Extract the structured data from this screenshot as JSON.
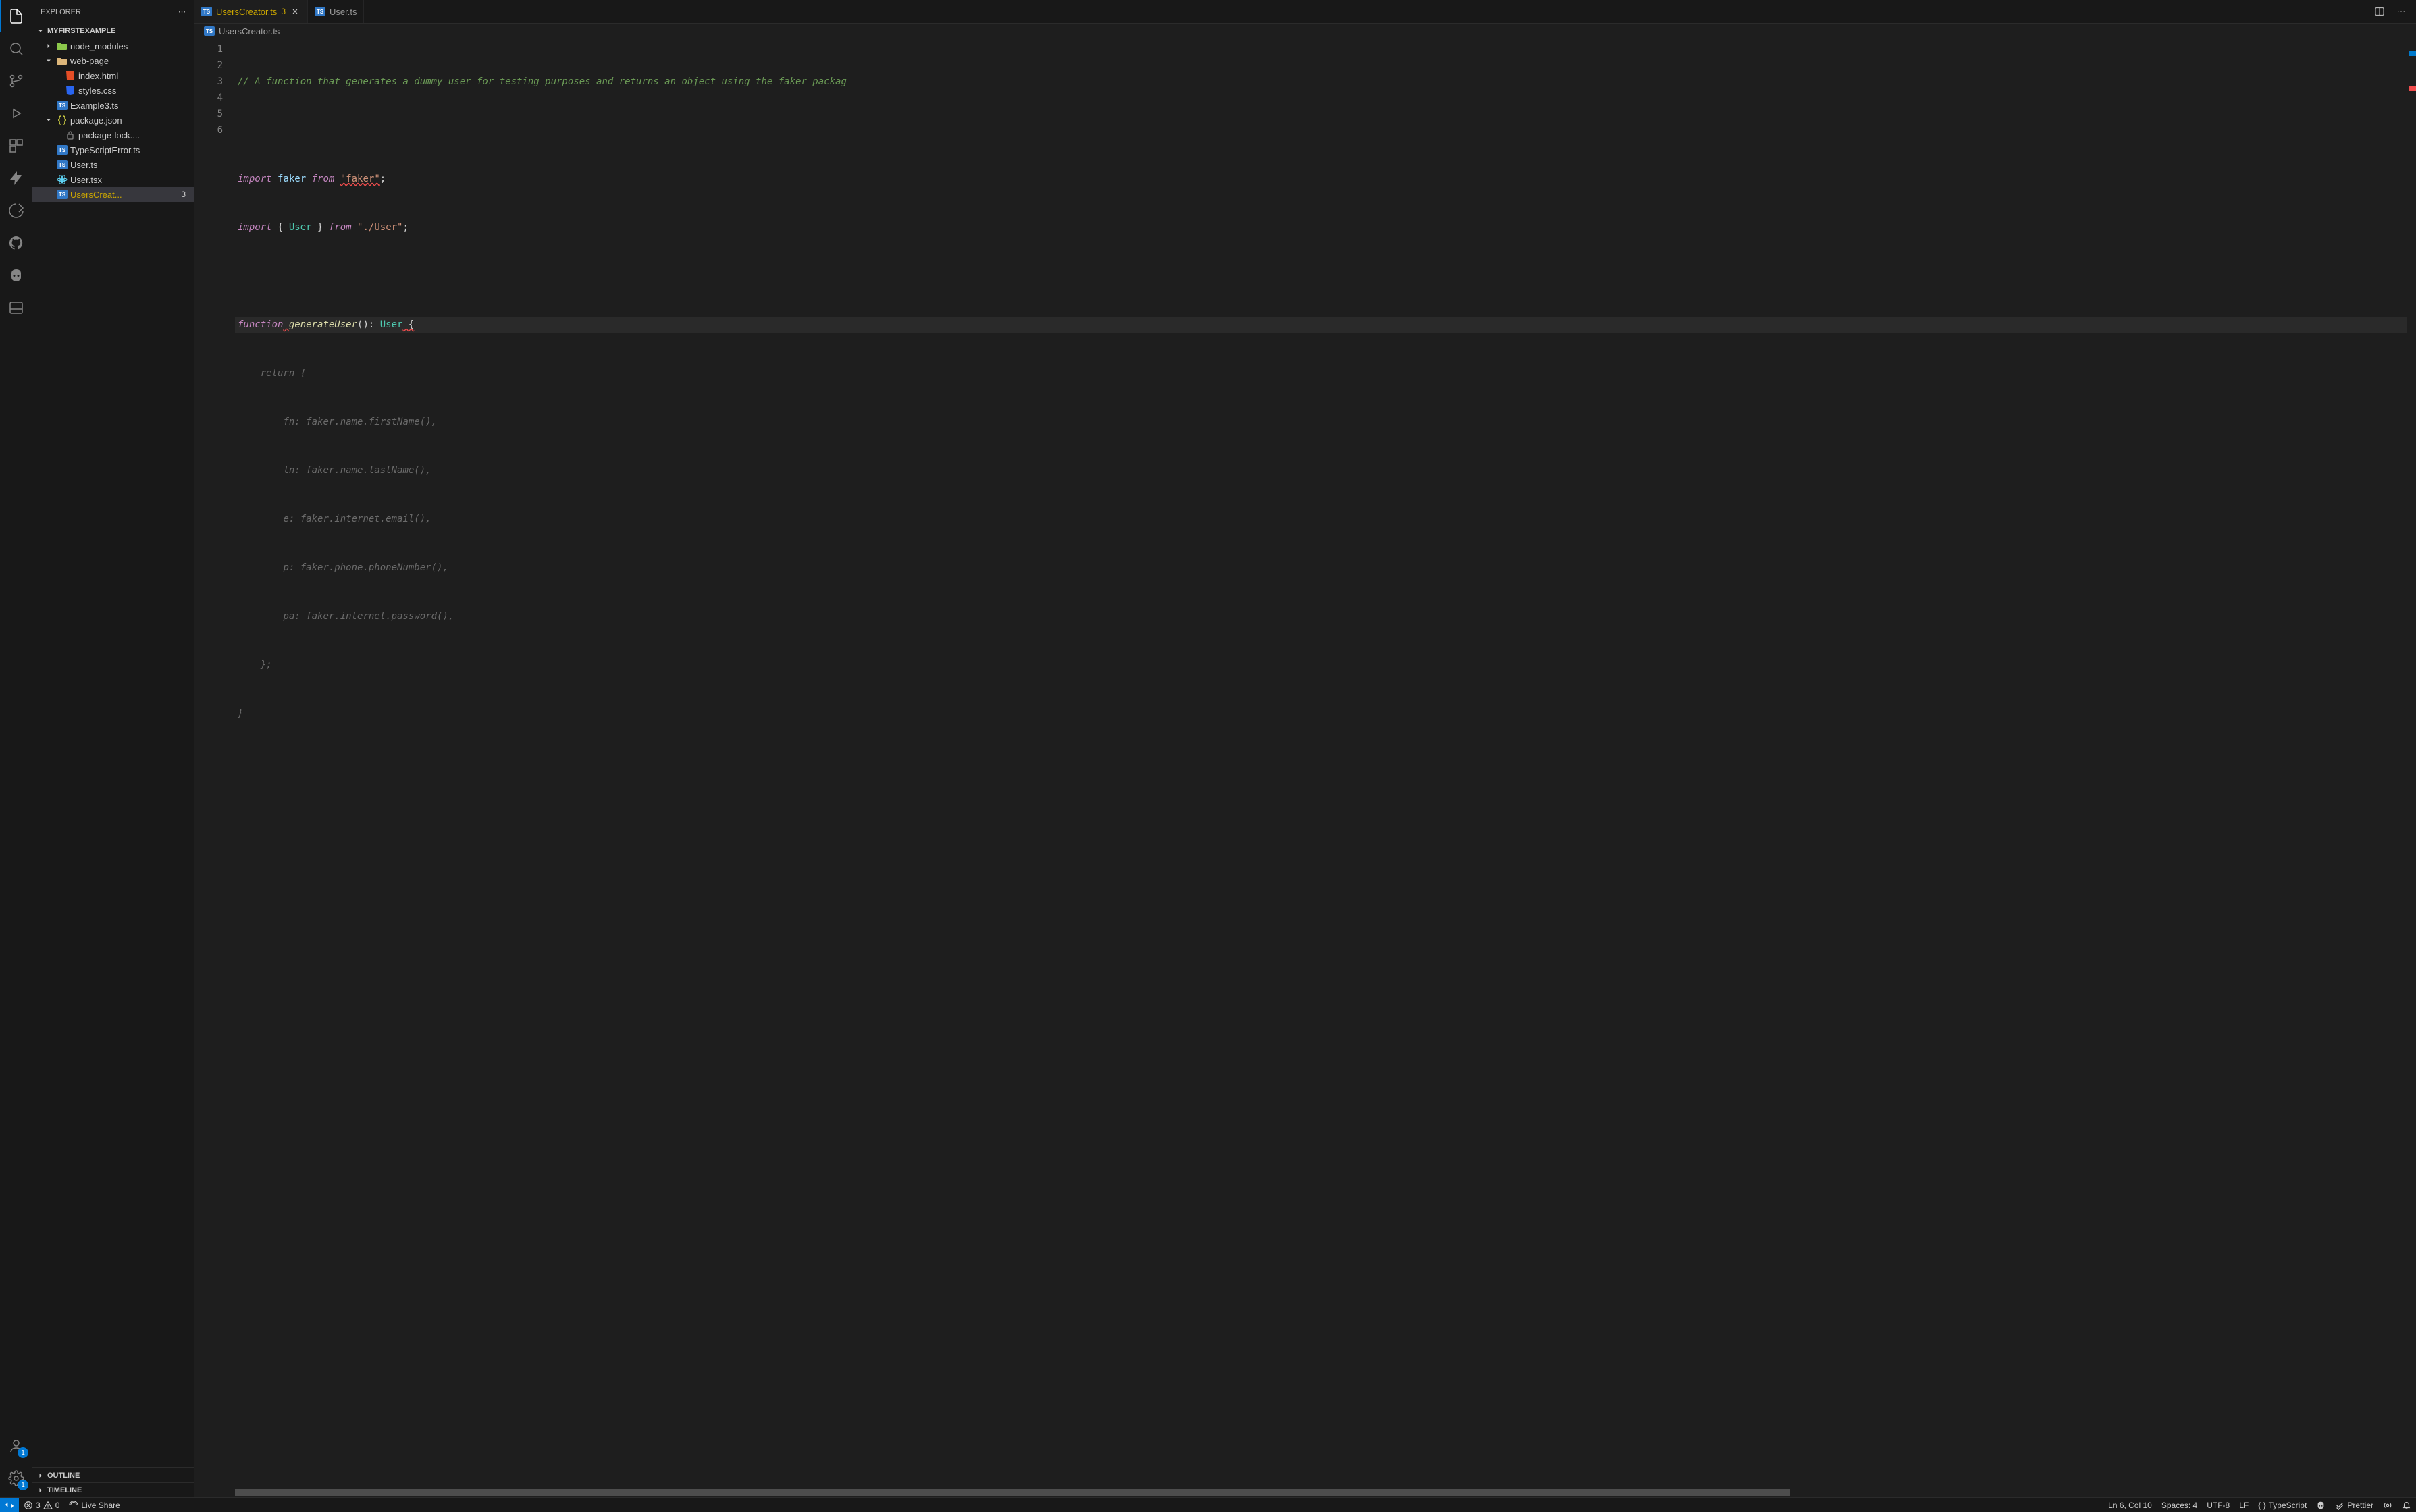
{
  "sidebar": {
    "title": "Explorer",
    "project": "MyFirstExample",
    "outline": "Outline",
    "timeline": "Timeline",
    "items": [
      {
        "label": "node_modules",
        "indent": 1,
        "icon": "nodemod",
        "twistie": "right"
      },
      {
        "label": "web-page",
        "indent": 1,
        "icon": "folder",
        "twistie": "down"
      },
      {
        "label": "index.html",
        "indent": 2,
        "icon": "html"
      },
      {
        "label": "styles.css",
        "indent": 2,
        "icon": "css"
      },
      {
        "label": "Example3.ts",
        "indent": 1,
        "icon": "ts"
      },
      {
        "label": "package.json",
        "indent": 1,
        "icon": "json",
        "twistie": "down"
      },
      {
        "label": "package-lock....",
        "indent": 2,
        "icon": "json-lock"
      },
      {
        "label": "TypeScriptError.ts",
        "indent": 1,
        "icon": "ts"
      },
      {
        "label": "User.ts",
        "indent": 1,
        "icon": "ts"
      },
      {
        "label": "User.tsx",
        "indent": 1,
        "icon": "react"
      },
      {
        "label": "UsersCreat...",
        "indent": 1,
        "icon": "ts",
        "warn": true,
        "badge": "3",
        "active": true
      }
    ]
  },
  "activity": {
    "account_badge": "1",
    "settings_badge": "1"
  },
  "tabs": [
    {
      "label": "UsersCreator.ts",
      "icon": "ts",
      "active": true,
      "warn": true,
      "badge": "3",
      "close": true
    },
    {
      "label": "User.ts",
      "icon": "ts",
      "active": false
    }
  ],
  "breadcrumb": {
    "file": "UsersCreator.ts"
  },
  "gutter": [
    "1",
    "2",
    "3",
    "4",
    "5",
    "6"
  ],
  "code": {
    "l1_comment": "// A function that generates a dummy user for testing purposes and returns an object using the faker packag",
    "l3": {
      "kw": "import",
      "id": "faker",
      "from": "from",
      "str": "\"faker\"",
      "end": ";"
    },
    "l4": {
      "kw": "import",
      "br1": "{ ",
      "id": "User",
      "br2": " }",
      "from": "from",
      "str": "\"./User\"",
      "end": ";"
    },
    "l6": {
      "kw": "function",
      "sp": " ",
      "name": "generateUser",
      "sig": "(): ",
      "type": "User",
      "open": " {"
    },
    "g1": "    return {",
    "g2": {
      "prop": "fn",
      "val": "faker.name.firstName(),"
    },
    "g3": {
      "prop": "ln",
      "val": "faker.name.lastName(),"
    },
    "g4": {
      "prop": "e",
      "val": "faker.internet.email(),"
    },
    "g5": {
      "prop": "p",
      "val": "faker.phone.phoneNumber(),"
    },
    "g6": {
      "prop": "pa",
      "val": "faker.internet.password(),"
    },
    "g7": "    };",
    "g8": "}"
  },
  "status": {
    "errors": "3",
    "warnings": "0",
    "live_share": "Live Share",
    "cursor": "Ln 6, Col 10",
    "spaces": "Spaces: 4",
    "encoding": "UTF-8",
    "eol": "LF",
    "language": "TypeScript",
    "prettier": "Prettier"
  }
}
